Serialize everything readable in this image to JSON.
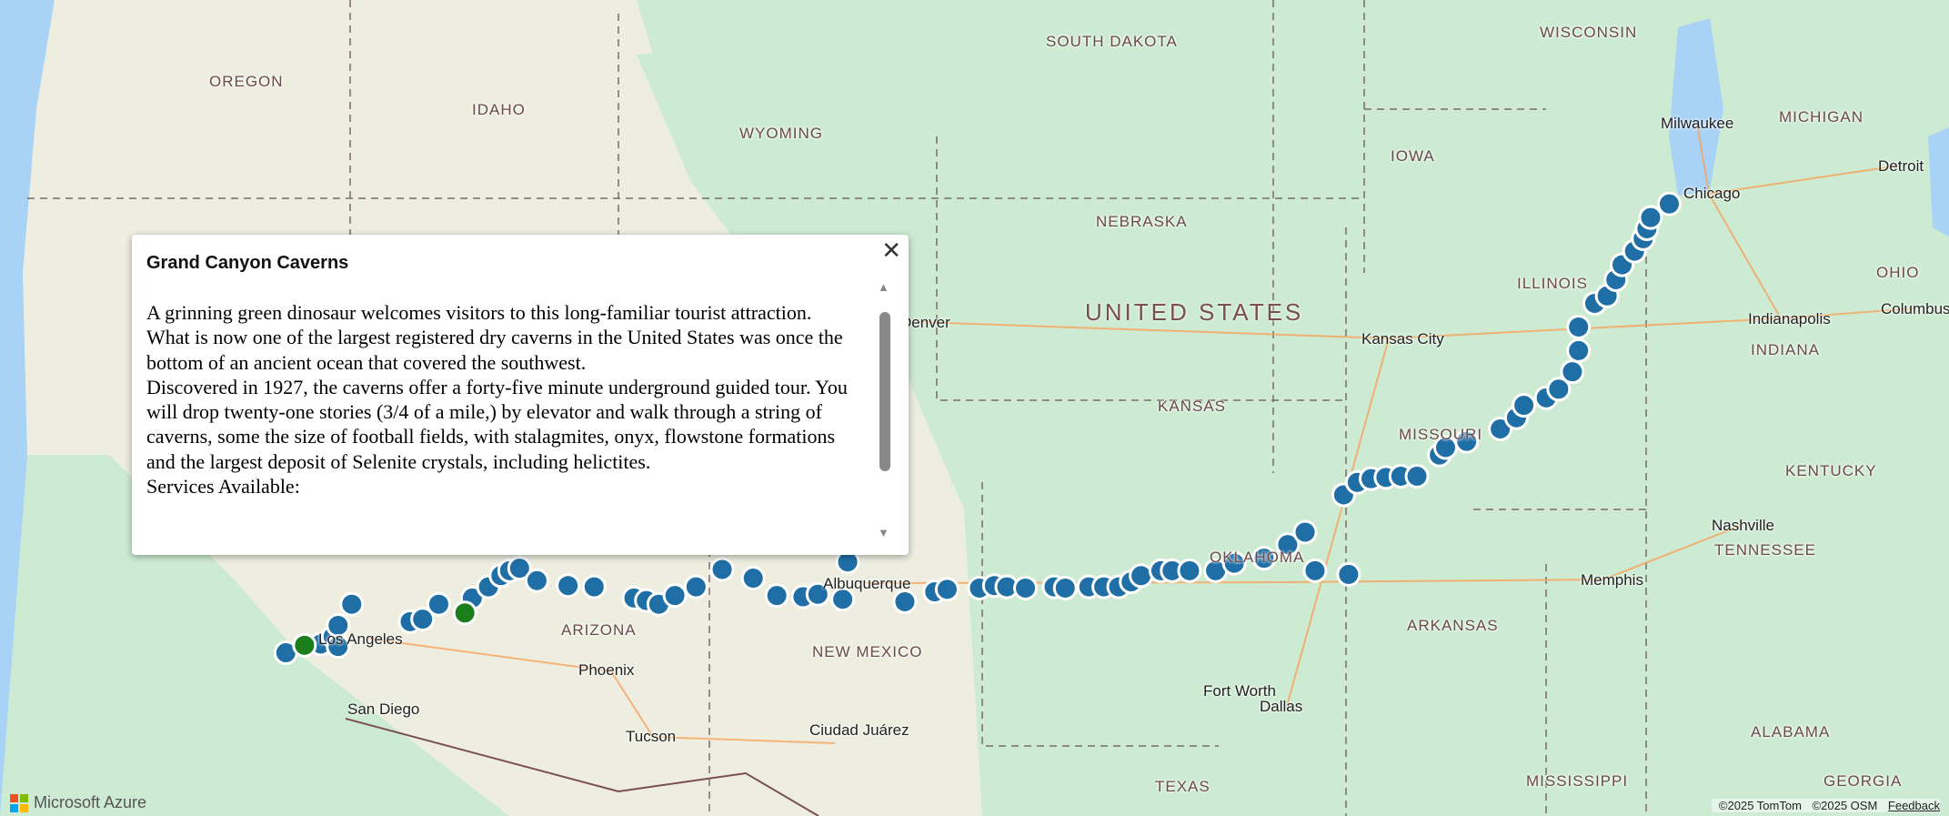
{
  "popup": {
    "title": "Grand Canyon Caverns",
    "close_label": "✕",
    "paragraphs": [
      "A grinning green dinosaur welcomes visitors to this long-familiar tourist attraction.",
      "What is now one of the largest registered dry caverns in the United States was once the bottom of an ancient ocean that covered the southwest.",
      "Discovered in 1927, the caverns offer a forty-five minute underground guided tour. You will drop twenty-one stories (3/4 of a mile,) by elevator and walk through a string of caverns, some the size of football fields, with stalagmites, onyx, flowstone formations and the largest deposit of Selenite crystals, including helictites.",
      "Services Available:"
    ]
  },
  "map": {
    "country": "UNITED STATES",
    "states": [
      "OREGON",
      "IDAHO",
      "WYOMING",
      "SOUTH DAKOTA",
      "WISCONSIN",
      "MICHIGAN",
      "IOWA",
      "NEBRASKA",
      "OHIO",
      "INDIANA",
      "KANSAS",
      "KENTUCKY",
      "TENNESSEE",
      "ARKANSAS",
      "ALABAMA",
      "MISSISSIPPI",
      "GEORGIA",
      "TEXAS",
      "ARIZONA",
      "NEW MEXICO",
      "ILLINOIS",
      "MISSOURI",
      "OKLAHOMA"
    ],
    "cities": [
      "Milwaukee",
      "Detroit",
      "Chicago",
      "Indianapolis",
      "Columbus",
      "Kansas City",
      "Nashville",
      "Memphis",
      "Fort Worth",
      "Dallas",
      "Ciudad Juárez",
      "Tucson",
      "Phoenix",
      "San Diego",
      "Los Angeles",
      "Albuquerque",
      "Denver"
    ],
    "marker_color": "#1f6fa6",
    "selected_marker_color": "#1a7f1a"
  },
  "footer": {
    "logo": "Microsoft Azure",
    "attribution": [
      "©2025 TomTom",
      "©2025 OSM"
    ],
    "feedback": "Feedback"
  }
}
